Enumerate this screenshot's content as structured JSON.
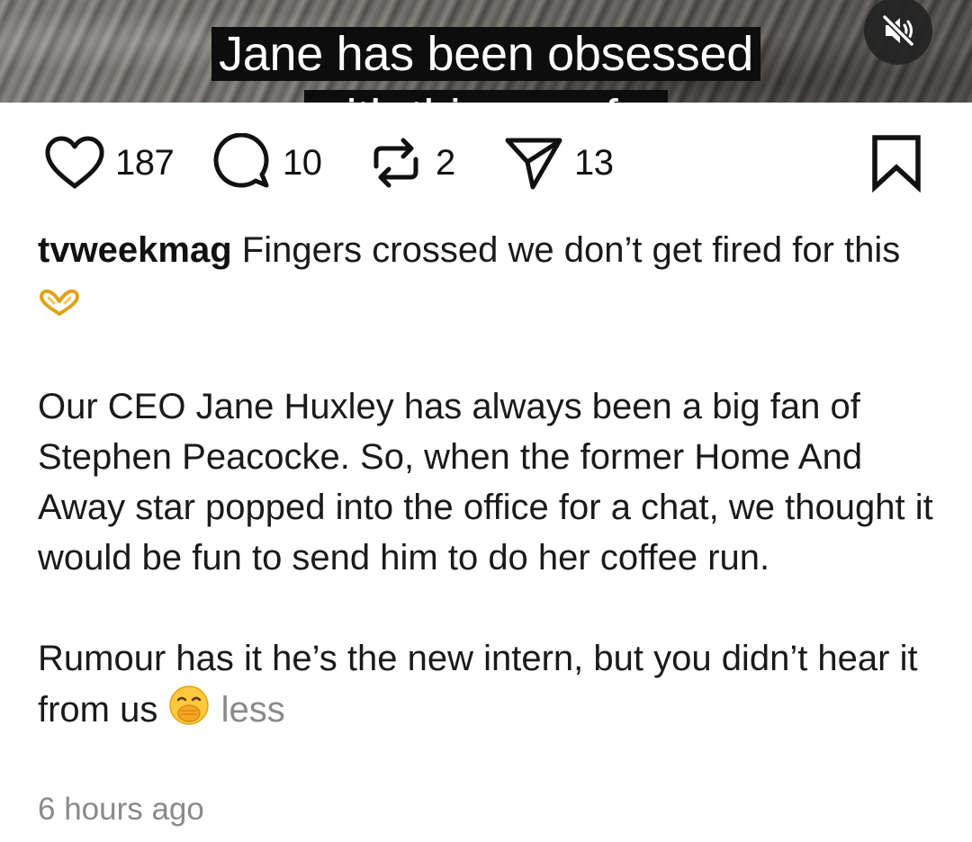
{
  "video": {
    "caption_line1": "Jane has been obsessed",
    "caption_line2": "with this man for",
    "mute_icon": "speaker-muted-icon"
  },
  "actions": {
    "like_count": "187",
    "comment_count": "10",
    "repost_count": "2",
    "share_count": "13",
    "icons": [
      "heart-icon",
      "comment-bubble-icon",
      "repost-icon",
      "send-icon",
      "bookmark-icon"
    ]
  },
  "post": {
    "username": "tvweekmag",
    "para1": "Fingers crossed we don’t get fired for this",
    "para1_emoji": "heart-hands-emoji",
    "para2": "Our CEO Jane Huxley has always been a big fan of Stephen Peacocke. So, when the former Home And Away star popped into the office for a chat, we thought it would be fun to send him to do her coffee run.",
    "para3": "Rumour has it he’s the new intern, but you didn’t hear it from us",
    "para3_emoji": "face-with-hand-over-mouth-emoji",
    "less_label": "less",
    "timestamp": "6 hours ago"
  }
}
